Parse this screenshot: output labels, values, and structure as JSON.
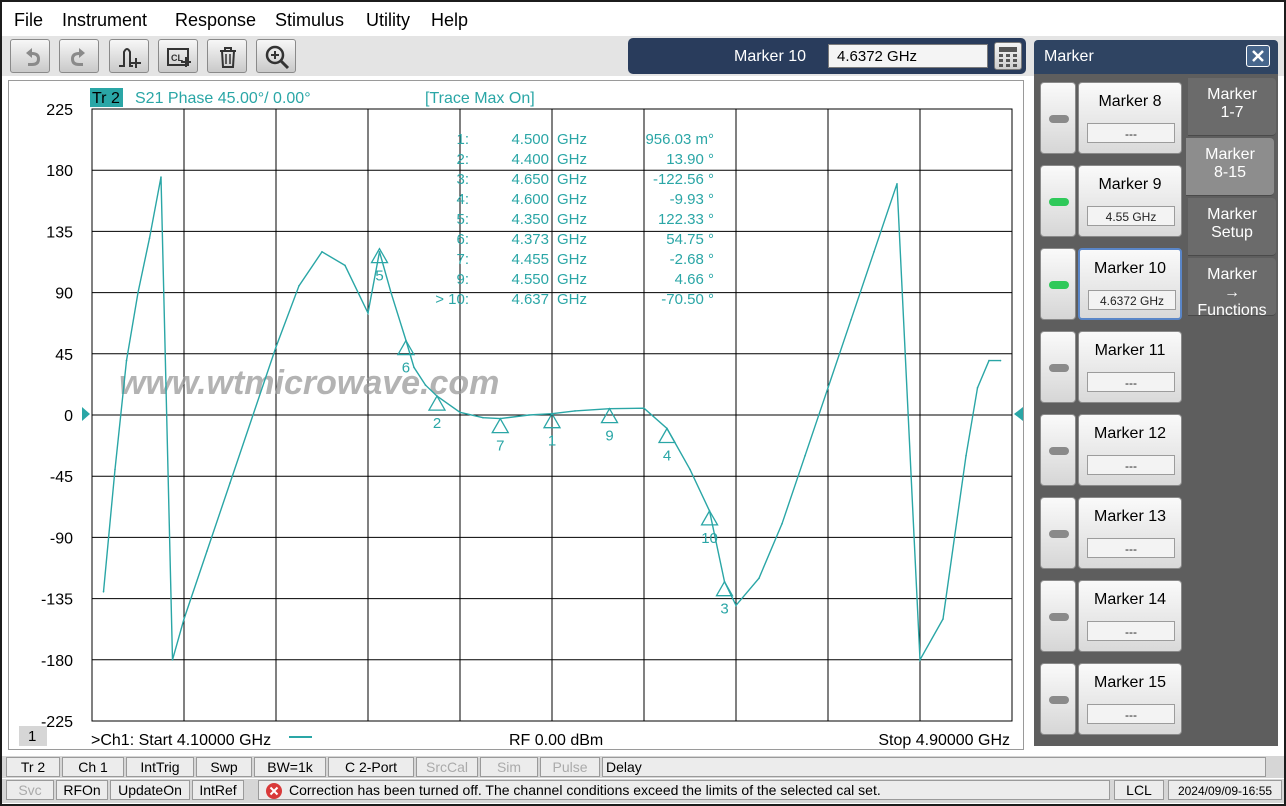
{
  "menu": [
    "File",
    "Instrument",
    "Response",
    "Stimulus",
    "Utility",
    "Help"
  ],
  "toolbar": {
    "icons": [
      "undo-icon",
      "redo-icon",
      "add-marker-icon",
      "cal-icon",
      "delete-icon",
      "zoom-icon"
    ]
  },
  "marker_entry": {
    "label": "Marker 10",
    "value": "4.6372 GHz"
  },
  "trace_header": {
    "trace": "Tr 2",
    "params": "S21 Phase 45.00°/  0.00°",
    "mode": "[Trace Max On]"
  },
  "channel_number": "1",
  "footer": {
    "start": ">Ch1:  Start  4.10000 GHz",
    "power": "RF    0.00 dBm",
    "stop": "Stop  4.90000 GHz"
  },
  "watermark": "www.wtmicrowave.com",
  "chart_data": {
    "type": "line",
    "title": "",
    "xlabel": "",
    "ylabel": "",
    "xlim": [
      4.1,
      4.9
    ],
    "ylim": [
      -225,
      225
    ],
    "yticks": [
      225,
      180,
      135,
      90,
      45,
      0,
      -45,
      -90,
      -135,
      -180,
      -225
    ],
    "grid": true,
    "series": [
      {
        "name": "S21 Phase",
        "color": "#2aa6a6",
        "x": [
          4.11,
          4.12,
          4.13,
          4.14,
          4.15,
          4.16,
          4.17,
          4.18,
          4.2,
          4.22,
          4.24,
          4.26,
          4.28,
          4.3,
          4.32,
          4.34,
          4.35,
          4.36,
          4.373,
          4.38,
          4.39,
          4.4,
          4.42,
          4.44,
          4.455,
          4.48,
          4.5,
          4.52,
          4.55,
          4.58,
          4.6,
          4.62,
          4.637,
          4.65,
          4.66,
          4.68,
          4.7,
          4.72,
          4.74,
          4.76,
          4.78,
          4.8,
          4.82,
          4.84,
          4.85,
          4.86,
          4.87,
          4.88,
          4.89
        ],
        "y": [
          -130,
          -40,
          40,
          90,
          130,
          175,
          -180,
          -150,
          -100,
          -50,
          0,
          50,
          95,
          120,
          110,
          75,
          120,
          90,
          54.75,
          35,
          22,
          13.9,
          2,
          -2,
          -2.68,
          0,
          0.96,
          3,
          4.66,
          5,
          -9.93,
          -40,
          -70.5,
          -122.56,
          -140,
          -120,
          -80,
          -30,
          20,
          70,
          120,
          170,
          -180,
          -150,
          -90,
          -30,
          20,
          40,
          40
        ]
      }
    ],
    "markers": [
      {
        "n": "1",
        "freq": "4.500",
        "unit": "GHz",
        "value": "956.03 m°",
        "y": 0.96
      },
      {
        "n": "2",
        "freq": "4.400",
        "unit": "GHz",
        "value": "13.90 °",
        "y": 13.9
      },
      {
        "n": "3",
        "freq": "4.650",
        "unit": "GHz",
        "value": "-122.56 °",
        "y": -122.56
      },
      {
        "n": "4",
        "freq": "4.600",
        "unit": "GHz",
        "value": "-9.93 °",
        "y": -9.93
      },
      {
        "n": "5",
        "freq": "4.350",
        "unit": "GHz",
        "value": "122.33 °",
        "y": 122.33
      },
      {
        "n": "6",
        "freq": "4.373",
        "unit": "GHz",
        "value": "54.75 °",
        "y": 54.75
      },
      {
        "n": "7",
        "freq": "4.455",
        "unit": "GHz",
        "value": "-2.68 °",
        "y": -2.68
      },
      {
        "n": "9",
        "freq": "4.550",
        "unit": "GHz",
        "value": "4.66 °",
        "y": 4.66
      },
      {
        "n": "10",
        "freq": "4.637",
        "unit": "GHz",
        "value": "-70.50 °",
        "y": -70.5,
        "active": true
      }
    ]
  },
  "softkeys": {
    "title": "Marker",
    "markers": [
      {
        "name": "Marker 8",
        "value": "---",
        "led": false
      },
      {
        "name": "Marker 9",
        "value": "4.55 GHz",
        "led": true
      },
      {
        "name": "Marker 10",
        "value": "4.6372 GHz",
        "led": true,
        "selected": true
      },
      {
        "name": "Marker 11",
        "value": "---",
        "led": false
      },
      {
        "name": "Marker 12",
        "value": "---",
        "led": false
      },
      {
        "name": "Marker 13",
        "value": "---",
        "led": false
      },
      {
        "name": "Marker 14",
        "value": "---",
        "led": false
      },
      {
        "name": "Marker 15",
        "value": "---",
        "led": false
      }
    ],
    "tabs": [
      {
        "label": "Marker 1-7"
      },
      {
        "label": "Marker 8-15",
        "active": true
      },
      {
        "label": "Marker Setup"
      },
      {
        "label": "Marker → Functions"
      }
    ]
  },
  "status1": [
    {
      "label": "Tr 2"
    },
    {
      "label": "Ch 1"
    },
    {
      "label": "IntTrig"
    },
    {
      "label": "Swp"
    },
    {
      "label": "BW=1k"
    },
    {
      "label": "C  2-Port"
    },
    {
      "label": "SrcCal",
      "disabled": true
    },
    {
      "label": "Sim",
      "disabled": true
    },
    {
      "label": "Pulse",
      "disabled": true
    },
    {
      "label": "Delay"
    }
  ],
  "status2": {
    "buttons": [
      {
        "label": "Svc",
        "disabled": true
      },
      {
        "label": "RFOn"
      },
      {
        "label": "UpdateOn"
      },
      {
        "label": "IntRef"
      }
    ],
    "message": "Correction has been turned off. The channel conditions exceed the limits of the selected cal set.",
    "lcl": "LCL",
    "datetime": "2024/09/09-16:55"
  }
}
